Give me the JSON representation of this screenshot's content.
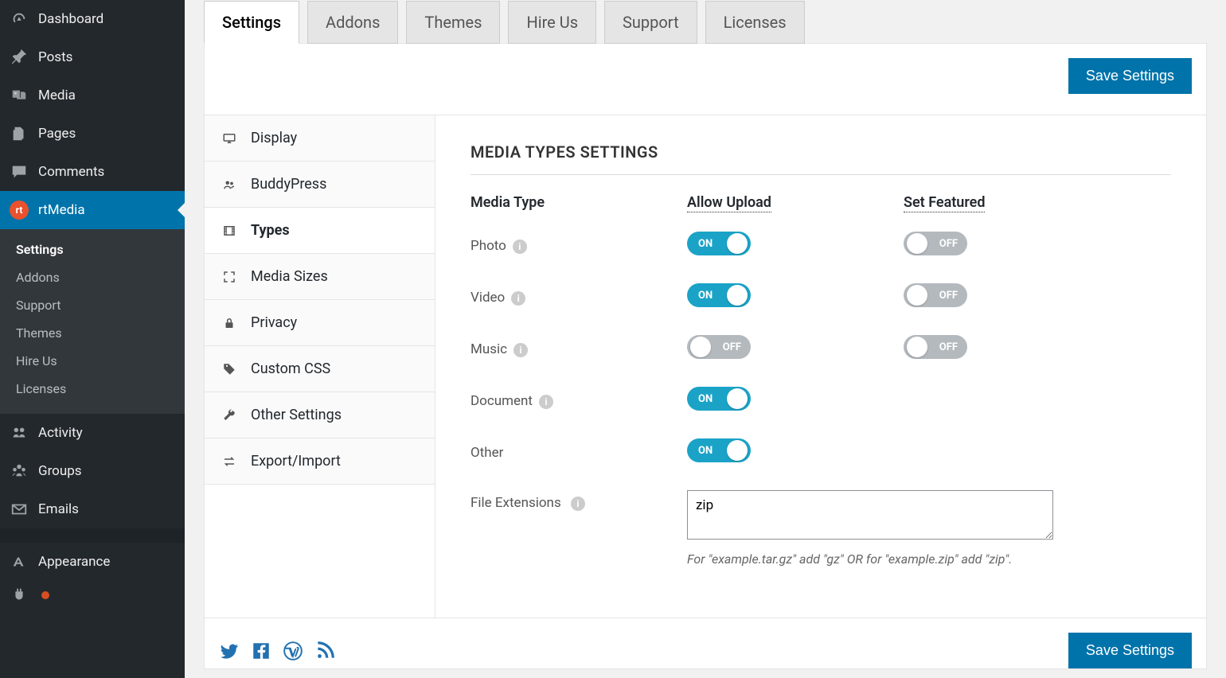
{
  "wp_sidebar": {
    "items": [
      {
        "label": "Dashboard",
        "icon": "gauge"
      },
      {
        "label": "Posts",
        "icon": "pin"
      },
      {
        "label": "Media",
        "icon": "media"
      },
      {
        "label": "Pages",
        "icon": "pages"
      },
      {
        "label": "Comments",
        "icon": "comment"
      },
      {
        "label": "rtMedia",
        "icon": "rt",
        "active": true
      },
      {
        "label": "Activity",
        "icon": "activity"
      },
      {
        "label": "Groups",
        "icon": "groups"
      },
      {
        "label": "Emails",
        "icon": "email"
      },
      {
        "label": "Appearance",
        "icon": "appearance"
      }
    ],
    "submenu": [
      {
        "label": "Settings",
        "current": true
      },
      {
        "label": "Addons"
      },
      {
        "label": "Support"
      },
      {
        "label": "Themes"
      },
      {
        "label": "Hire Us"
      },
      {
        "label": "Licenses"
      }
    ]
  },
  "top_tabs": [
    "Settings",
    "Addons",
    "Themes",
    "Hire Us",
    "Support",
    "Licenses"
  ],
  "save_button": "Save Settings",
  "settings_nav": [
    {
      "label": "Display",
      "icon": "display"
    },
    {
      "label": "BuddyPress",
      "icon": "group"
    },
    {
      "label": "Types",
      "icon": "film",
      "active": true
    },
    {
      "label": "Media Sizes",
      "icon": "expand"
    },
    {
      "label": "Privacy",
      "icon": "lock"
    },
    {
      "label": "Custom CSS",
      "icon": "tag"
    },
    {
      "label": "Other Settings",
      "icon": "wrench"
    },
    {
      "label": "Export/Import",
      "icon": "transfer"
    }
  ],
  "content": {
    "title": "MEDIA TYPES SETTINGS",
    "headers": {
      "type": "Media Type",
      "upload": "Allow Upload",
      "featured": "Set Featured"
    },
    "rows": [
      {
        "label": "Photo",
        "help": true,
        "upload": "ON",
        "featured": "OFF"
      },
      {
        "label": "Video",
        "help": true,
        "upload": "ON",
        "featured": "OFF"
      },
      {
        "label": "Music",
        "help": true,
        "upload": "OFF",
        "featured": "OFF"
      },
      {
        "label": "Document",
        "help": true,
        "upload": "ON",
        "featured": null
      },
      {
        "label": "Other",
        "help": false,
        "upload": "ON",
        "featured": null
      }
    ],
    "file_ext_label": "File Extensions",
    "file_ext_value": "zip",
    "file_ext_hint": "For \"example.tar.gz\" add \"gz\" OR for \"example.zip\" add \"zip\".",
    "toggle_on": "ON",
    "toggle_off": "OFF"
  }
}
